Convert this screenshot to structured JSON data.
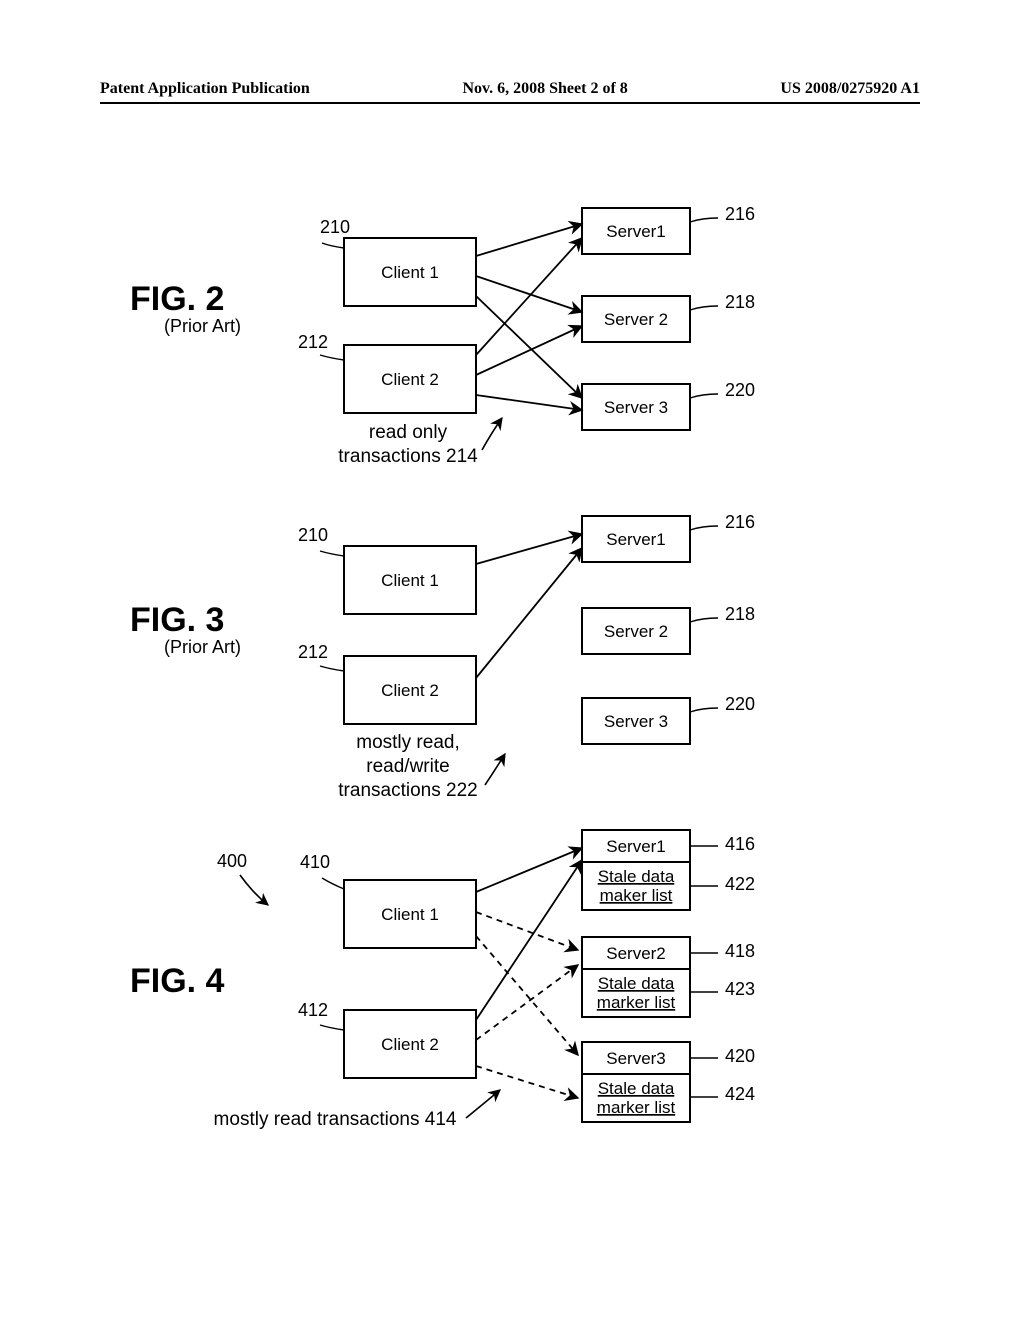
{
  "header": {
    "left": "Patent Application Publication",
    "mid": "Nov. 6, 2008  Sheet 2 of 8",
    "right": "US 2008/0275920 A1"
  },
  "fig2": {
    "title": "FIG. 2",
    "subtitle": "(Prior Art)",
    "clients": {
      "c1": "Client 1",
      "c2": "Client 2"
    },
    "servers": {
      "s1": "Server1",
      "s2": "Server 2",
      "s3": "Server 3"
    },
    "refs": {
      "c1": "210",
      "c2": "212",
      "s1": "216",
      "s2": "218",
      "s3": "220",
      "trans": "214"
    },
    "caption1": "read only",
    "caption2": "transactions 214"
  },
  "fig3": {
    "title": "FIG. 3",
    "subtitle": "(Prior Art)",
    "clients": {
      "c1": "Client 1",
      "c2": "Client 2"
    },
    "servers": {
      "s1": "Server1",
      "s2": "Server 2",
      "s3": "Server 3"
    },
    "refs": {
      "c1": "210",
      "c2": "212",
      "s1": "216",
      "s2": "218",
      "s3": "220"
    },
    "caption1": "mostly read,",
    "caption2": "read/write",
    "caption3": "transactions 222"
  },
  "fig4": {
    "title": "FIG. 4",
    "clients": {
      "c1": "Client 1",
      "c2": "Client 2"
    },
    "servers": {
      "s1": "Server1",
      "s2": "Server2",
      "s3": "Server3",
      "sd1a": "Stale data",
      "sd1b": "maker list",
      "sd2a": "Stale data",
      "sd2b": "marker list",
      "sd3a": "Stale data",
      "sd3b": "marker list"
    },
    "refs": {
      "fig": "400",
      "c1": "410",
      "c2": "412",
      "s1": "416",
      "sd1": "422",
      "s2": "418",
      "sd2": "423",
      "s3": "420",
      "sd3": "424"
    },
    "caption": "mostly read transactions 414"
  }
}
